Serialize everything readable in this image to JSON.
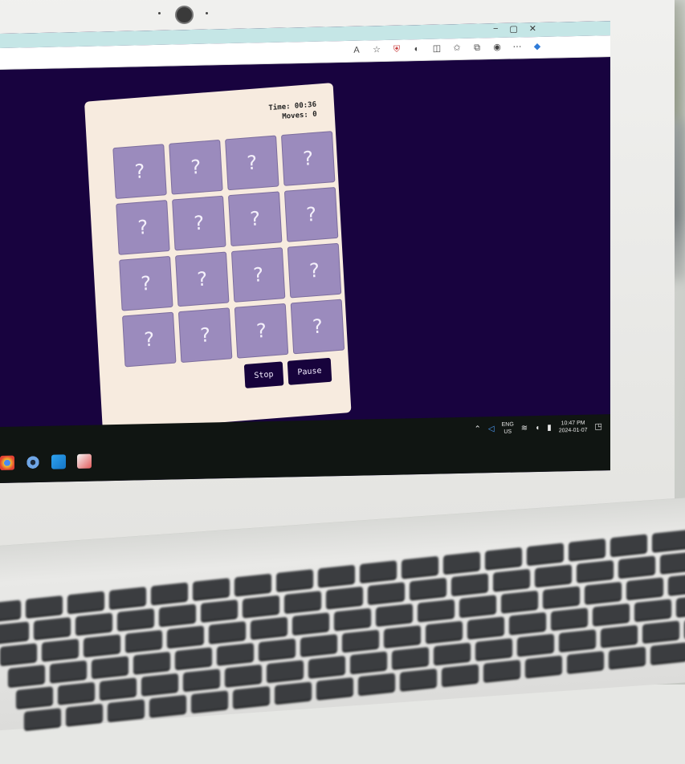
{
  "window": {
    "minimize": "−",
    "maximize": "▢",
    "close": "✕"
  },
  "toolbar_icons": [
    "read-aloud-icon",
    "favorite-star-icon",
    "shield-extension-icon",
    "extension-icon",
    "split-screen-icon",
    "favorites-icon",
    "collections-icon",
    "profile-icon",
    "more-icon",
    "copilot-icon"
  ],
  "game": {
    "time_text": "Time: 00:36",
    "moves_text": "Moves: 0",
    "tile_label": "?",
    "tile_count": 16,
    "stop_label": "Stop",
    "pause_label": "Pause"
  },
  "taskbar": {
    "lang_top": "ENG",
    "lang_bottom": "US",
    "time": "10:47 PM",
    "date": "2024-01-07"
  },
  "colors": {
    "page_background": "#18033f",
    "card_background": "#f7ebdf",
    "tile": "#9b8bbd",
    "button": "#17033c"
  }
}
